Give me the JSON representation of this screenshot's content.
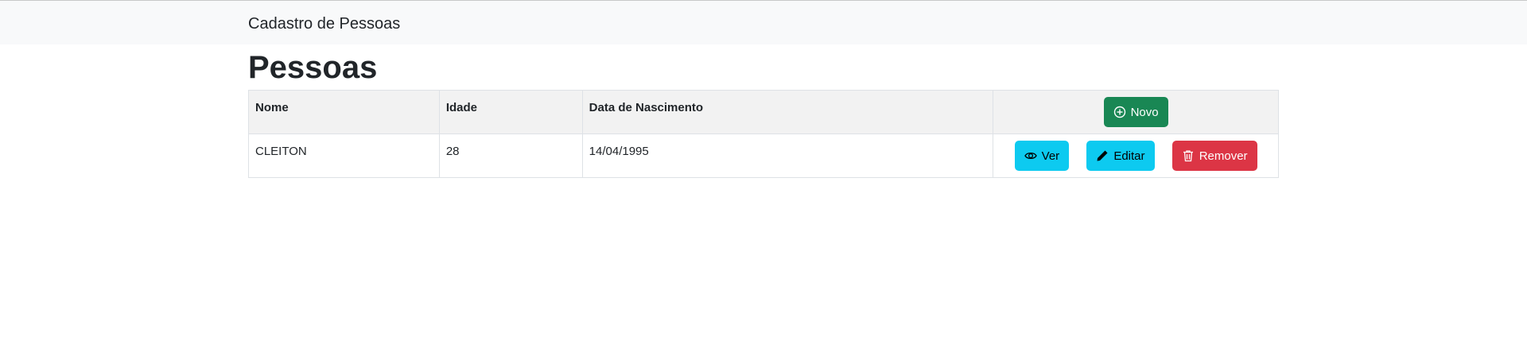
{
  "navbar": {
    "brand": "Cadastro de Pessoas"
  },
  "page": {
    "title": "Pessoas"
  },
  "table": {
    "headers": [
      "Nome",
      "Idade",
      "Data de Nascimento"
    ],
    "new_button_label": "Novo",
    "rows": [
      {
        "nome": "CLEITON",
        "idade": "28",
        "nascimento": "14/04/1995",
        "actions": {
          "view_label": "Ver",
          "edit_label": "Editar",
          "remove_label": "Remover"
        }
      }
    ]
  },
  "colors": {
    "navbar_bg": "#f8f9fa",
    "success": "#198754",
    "info": "#0dcaf0",
    "danger": "#dc3545"
  },
  "icons": {
    "new": "plus-circle-icon",
    "view": "eye-icon",
    "edit": "pencil-icon",
    "remove": "trash-icon"
  }
}
